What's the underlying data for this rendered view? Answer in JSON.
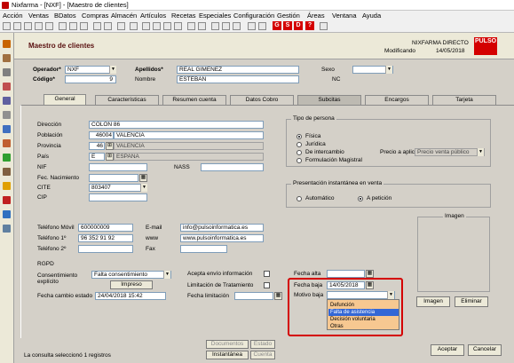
{
  "window": {
    "title": "Nixfarma - [NXF] - [Maestro de clientes]"
  },
  "menu": [
    "Acción",
    "Ventas",
    "BDatos",
    "Compras",
    "Almacén",
    "Artículos",
    "Recetas",
    "Especiales",
    "Configuración",
    "Gestión",
    "Áreas",
    "Ventana",
    "Ayuda"
  ],
  "toolbar": {
    "red_buttons": [
      "G",
      "S",
      "D",
      "?"
    ]
  },
  "header": {
    "title": "Maestro de clientes",
    "company": "NIXFARMA DIRECTO",
    "status": "Modificando",
    "date": "14/05/2018",
    "logo": "PULSO"
  },
  "client": {
    "operador_label": "Operador*",
    "operador": "NXF",
    "codigo_label": "Código*",
    "codigo": "9",
    "apellidos_label": "Apellidos*",
    "apellidos": "REAL GIMENEZ",
    "nombre_label": "Nombre",
    "nombre": "ESTEBAN",
    "sexo_label": "Sexo",
    "sexo": "",
    "nc_label": "NC"
  },
  "tabs": [
    "General",
    "Características",
    "Resumen cuenta",
    "Datos Cobro",
    "Subcitas",
    "Encargos",
    "Tarjeta"
  ],
  "general": {
    "direccion_label": "Dirección",
    "direccion": "COLON 86",
    "poblacion_label": "Población",
    "poblacion_code": "46004",
    "poblacion": "VALENCIA",
    "provincia_label": "Provincia",
    "provincia_code": "46",
    "provincia": "VALENCIA",
    "pais_label": "País",
    "pais_code": "E",
    "pais": "ESPAÑA",
    "nif_label": "NIF",
    "nass_label": "NASS",
    "fec_nac_label": "Fec. Nacimiento",
    "cite_label": "CITE",
    "cite": "803407",
    "cip_label": "CIP",
    "tel_movil_label": "Teléfono Móvil",
    "tel_movil": "600000009",
    "tel1_label": "Teléfono 1º",
    "tel1": "96 352 91 92",
    "tel2_label": "Teléfono 2º",
    "email_label": "E-mail",
    "email": "info@pulsoinformatica.es",
    "www_label": "www",
    "www": "www.pulsoinformatica.es",
    "fax_label": "Fax"
  },
  "tipo_persona": {
    "title": "Tipo de persona",
    "options": [
      "Física",
      "Jurídica",
      "De intercambio",
      "Formulación Magistral"
    ],
    "selected": "Física",
    "precio_label": "Precio a aplicar",
    "precio": "Precio venta público"
  },
  "presentacion": {
    "title": "Presentación instantánea en venta",
    "options": [
      "Automático",
      "A petición"
    ],
    "selected": "A petición"
  },
  "imagen": {
    "title": "Imagen",
    "imagen_button": "Imagen",
    "eliminar_button": "Eliminar"
  },
  "rgpd": {
    "title": "RGPD",
    "consentimiento_label": "Consentimiento explícito",
    "consentimiento": "Falta consentimiento",
    "impreso_button": "Impreso",
    "fecha_cambio_label": "Fecha cambio estado",
    "fecha_cambio": "24/04/2018 15:42",
    "acepta_envio_label": "Acepta envío información",
    "limitacion_label": "Limitación de Tratamiento",
    "fecha_limitacion_label": "Fecha limitación",
    "fecha_alta_label": "Fecha alta",
    "fecha_baja_label": "Fecha baja",
    "fecha_baja": "14/05/2018",
    "motivo_baja_label": "Motivo baja",
    "motivo_options": [
      "Defunción",
      "Falta de asistencia",
      "Decisión voluntaria",
      "Otras"
    ],
    "motivo_selected": "Falta de asistencia"
  },
  "footer": {
    "status": "La consulta seleccionó 1  registros",
    "buttons": [
      "Documentos",
      "Estado",
      "Instantánea",
      "Cuenta"
    ],
    "aceptar": "Aceptar",
    "cancelar": "Cancelar"
  },
  "colors": {
    "accent_red": "#d40000",
    "highlight": "#d40000",
    "dropdown_bg": "#f7c891",
    "selection": "#3367d6"
  }
}
